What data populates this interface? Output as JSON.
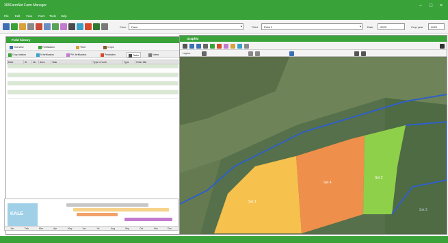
{
  "window": {
    "title": "365FarmNet Farm Manager"
  },
  "menu": {
    "items": [
      "File",
      "Edit",
      "View",
      "Farm",
      "Tools",
      "Help"
    ]
  },
  "toolbar": {
    "combo1": {
      "label": "Farm",
      "value": "Farm"
    },
    "combo2": {
      "label": "Field",
      "value": "Field 1"
    },
    "date": {
      "label": "Date",
      "value": "2023"
    },
    "crop": {
      "label": "Crop year",
      "value": "2023"
    }
  },
  "field_history": {
    "title": "Field history",
    "tabs_top": [
      "Overview",
      "Fertilization",
      "Yield",
      "Crops"
    ],
    "tabs_bottom": [
      "Crop rotation",
      "N fertilization",
      "P/K fertilization",
      "Pesticides",
      "Tasks",
      "Notes"
    ],
    "columns": [
      "Date",
      "ID",
      "No",
      "Area",
      "Task",
      "Type of work",
      "Type",
      "Order title"
    ],
    "rows": [
      [
        "",
        "",
        "",
        "",
        "",
        "",
        "",
        ""
      ],
      [
        "",
        "",
        "",
        "",
        "",
        "",
        "",
        ""
      ],
      [
        "",
        "",
        "",
        "",
        "",
        "",
        "",
        ""
      ],
      [
        "",
        "",
        "",
        "",
        "",
        "",
        "",
        ""
      ],
      [
        "",
        "",
        "",
        "",
        "",
        "",
        "",
        ""
      ],
      [
        "",
        "",
        "",
        "",
        "",
        "",
        "",
        ""
      ],
      [
        "",
        "",
        "",
        "",
        "",
        "",
        "",
        ""
      ],
      [
        "",
        "",
        "",
        "",
        "",
        "",
        "",
        ""
      ]
    ],
    "legend": [
      {
        "label": "",
        "color": "#c7c7c7"
      },
      {
        "label": "",
        "color": "#f0a26a"
      },
      {
        "label": "",
        "color": "#f7d28a"
      },
      {
        "label": "",
        "color": "#9fd0e8"
      }
    ],
    "buttons": {
      "create": "",
      "assign": ""
    },
    "timeline_title": "",
    "crop_label": "KALE",
    "months": [
      "Jan",
      "Feb",
      "Mar",
      "Apr",
      "May",
      "Jun",
      "Jul",
      "Aug",
      "Sep",
      "Oct",
      "Nov",
      "Dec"
    ]
  },
  "graphic": {
    "title": "Graphic",
    "layers_label": "Layers",
    "field_labels": [
      "Set 1",
      "Set 2",
      "Set 3",
      "Set 4"
    ]
  },
  "colors": {
    "brand": "#39a33a",
    "yellow_field": "#f6c14d",
    "orange_field": "#ee8f4b",
    "green_field": "#8fd04a",
    "boundary": "#2f5fc8"
  }
}
